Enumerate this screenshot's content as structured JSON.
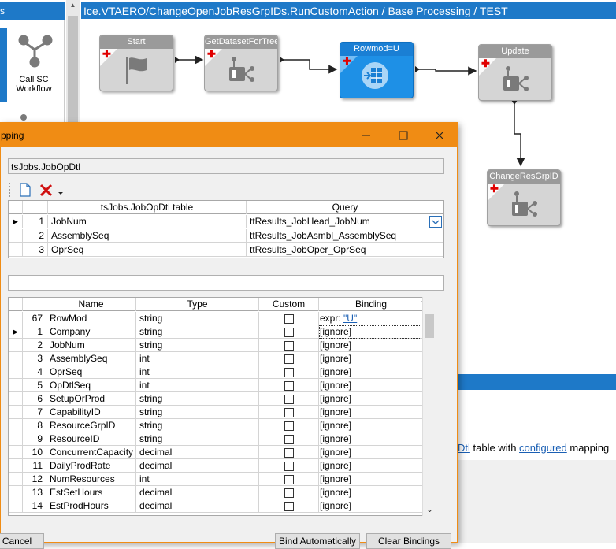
{
  "left_panel": {
    "header_label": "s",
    "tool": {
      "label_line1": "Call SC",
      "label_line2": "Workflow"
    }
  },
  "canvas": {
    "title": "Ice.VTAERO/ChangeOpenJobResGrpIDs.RunCustomAction / Base Processing / TEST",
    "nodes": [
      {
        "label": "Start"
      },
      {
        "label": "GetDatasetForTree"
      },
      {
        "label": "Rowmod=U"
      },
      {
        "label": "Update"
      },
      {
        "label": "ChangeResGrpID"
      }
    ]
  },
  "dialog": {
    "title": "pping",
    "path": "tsJobs.JobOpDtl",
    "mapping_grid": {
      "columns": [
        "tsJobs.JobOpDtl table",
        "Query"
      ],
      "rows": [
        {
          "num": "1",
          "field": "JobNum",
          "query": "ttResults_JobHead_JobNum"
        },
        {
          "num": "2",
          "field": "AssemblySeq",
          "query": "ttResults_JobAsmbl_AssemblySeq"
        },
        {
          "num": "3",
          "field": "OprSeq",
          "query": "ttResults_JobOper_OprSeq"
        }
      ]
    },
    "fields_grid": {
      "columns": [
        "Name",
        "Type",
        "Custom",
        "Binding"
      ],
      "rows": [
        {
          "num": "67",
          "name": "RowMod",
          "type": "string",
          "binding_prefix": "expr: ",
          "binding_link": "\"U\""
        },
        {
          "num": "1",
          "name": "Company",
          "type": "string",
          "binding": "[ignore]"
        },
        {
          "num": "2",
          "name": "JobNum",
          "type": "string",
          "binding": "[ignore]"
        },
        {
          "num": "3",
          "name": "AssemblySeq",
          "type": "int",
          "binding": "[ignore]"
        },
        {
          "num": "4",
          "name": "OprSeq",
          "type": "int",
          "binding": "[ignore]"
        },
        {
          "num": "5",
          "name": "OpDtlSeq",
          "type": "int",
          "binding": "[ignore]"
        },
        {
          "num": "6",
          "name": "SetupOrProd",
          "type": "string",
          "binding": "[ignore]"
        },
        {
          "num": "7",
          "name": "CapabilityID",
          "type": "string",
          "binding": "[ignore]"
        },
        {
          "num": "8",
          "name": "ResourceGrpID",
          "type": "string",
          "binding": "[ignore]"
        },
        {
          "num": "9",
          "name": "ResourceID",
          "type": "string",
          "binding": "[ignore]"
        },
        {
          "num": "10",
          "name": "ConcurrentCapacity",
          "type": "decimal",
          "binding": "[ignore]"
        },
        {
          "num": "11",
          "name": "DailyProdRate",
          "type": "decimal",
          "binding": "[ignore]"
        },
        {
          "num": "12",
          "name": "NumResources",
          "type": "int",
          "binding": "[ignore]"
        },
        {
          "num": "13",
          "name": "EstSetHours",
          "type": "decimal",
          "binding": "[ignore]"
        },
        {
          "num": "14",
          "name": "EstProdHours",
          "type": "decimal",
          "binding": "[ignore]"
        }
      ]
    },
    "buttons": {
      "cancel": "Cancel",
      "bind_auto": "Bind Automatically",
      "clear": "Clear Bindings"
    }
  },
  "right_description": {
    "part1": "Dtl",
    "part2": " table with ",
    "link": "configured",
    "part3": " mapping"
  },
  "colors": {
    "accent_blue": "#1e79c8",
    "dialog_orange": "#f08c14",
    "active_node": "#1e90e6"
  }
}
